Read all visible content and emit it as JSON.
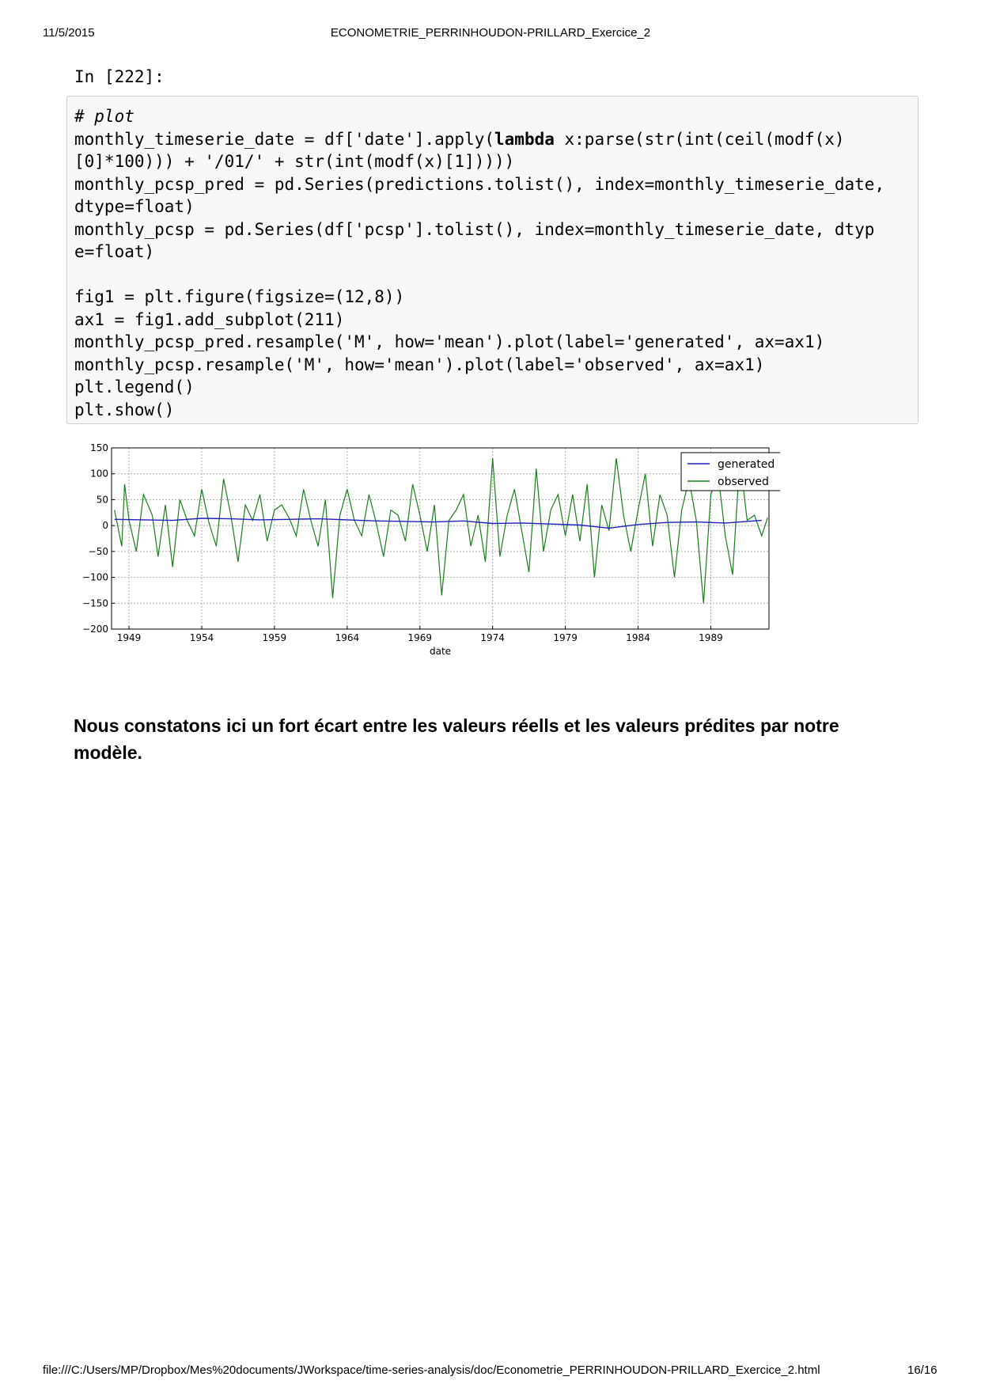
{
  "header": {
    "date": "11/5/2015",
    "title": "ECONOMETRIE_PERRINHOUDON-PRILLARD_Exercice_2"
  },
  "cell": {
    "prompt": "In [222]:",
    "lines": [
      [
        {
          "t": "# plot",
          "c": "cmt"
        }
      ],
      [
        {
          "t": "monthly_timeserie_date = df['date'].apply("
        },
        {
          "t": "lambda",
          "c": "kw"
        },
        {
          "t": " x:parse(str(int(ceil(modf(x)"
        }
      ],
      [
        {
          "t": "[0]*100))) + '/01/' + str(int(modf(x)[1]))))"
        }
      ],
      [
        {
          "t": "monthly_pcsp_pred = pd.Series(predictions.tolist(), index=monthly_timeserie_date,"
        }
      ],
      [
        {
          "t": "dtype=float)"
        }
      ],
      [
        {
          "t": "monthly_pcsp = pd.Series(df['pcsp'].tolist(), index=monthly_timeserie_date, dtyp"
        }
      ],
      [
        {
          "t": "e=float)"
        }
      ],
      [
        {
          "t": ""
        }
      ],
      [
        {
          "t": "fig1 = plt.figure(figsize=(12,8))"
        }
      ],
      [
        {
          "t": "ax1 = fig1.add_subplot(211)"
        }
      ],
      [
        {
          "t": "monthly_pcsp_pred.resample('M', how='mean').plot(label='generated', ax=ax1)"
        }
      ],
      [
        {
          "t": "monthly_pcsp.resample('M', how='mean').plot(label='observed', ax=ax1)"
        }
      ],
      [
        {
          "t": "plt.legend()"
        }
      ],
      [
        {
          "t": "plt.show()"
        }
      ]
    ]
  },
  "chart_data": {
    "type": "line",
    "title": "",
    "xlabel": "date",
    "ylabel": "",
    "xlim": [
      1947.8,
      1993.0
    ],
    "ylim": [
      -200,
      150
    ],
    "xticks": [
      1949,
      1954,
      1959,
      1964,
      1969,
      1974,
      1979,
      1984,
      1989
    ],
    "xtick_labels": [
      "1949",
      "1954",
      "1959",
      "1964",
      "1969",
      "1974",
      "1979",
      "1984",
      "1989"
    ],
    "yticks": [
      150,
      100,
      50,
      0,
      -50,
      -100,
      -150,
      -200
    ],
    "ytick_labels": [
      "150",
      "100",
      "50",
      "0",
      "−50",
      "−100",
      "−150",
      "−200"
    ],
    "grid": true,
    "legend_position": "top-right",
    "series": [
      {
        "name": "generated",
        "color": "#1f1fbf",
        "x": [
          1948,
          1950,
          1952,
          1954,
          1956,
          1958,
          1960,
          1962,
          1964,
          1966,
          1968,
          1970,
          1972,
          1974,
          1976,
          1978,
          1980,
          1982,
          1984,
          1986,
          1988,
          1990,
          1992.5
        ],
        "y": [
          12,
          11,
          10,
          14,
          13,
          11,
          12,
          13,
          11,
          9,
          8,
          7,
          9,
          4,
          5,
          3,
          1,
          -5,
          2,
          6,
          7,
          5,
          10
        ]
      },
      {
        "name": "observed",
        "color": "#1a7f1a",
        "x": [
          1948.0,
          1948.5,
          1948.7,
          1949.0,
          1949.5,
          1950.0,
          1950.6,
          1951.0,
          1951.5,
          1952.0,
          1952.5,
          1953.0,
          1953.5,
          1954.0,
          1954.5,
          1955.0,
          1955.5,
          1956.0,
          1956.5,
          1957.0,
          1957.5,
          1958.0,
          1958.5,
          1959.0,
          1959.5,
          1960.0,
          1960.5,
          1961.0,
          1961.5,
          1962.0,
          1962.5,
          1963.0,
          1963.5,
          1964.0,
          1964.5,
          1965.0,
          1965.5,
          1966.0,
          1966.5,
          1967.0,
          1967.5,
          1968.0,
          1968.5,
          1969.0,
          1969.5,
          1970.0,
          1970.5,
          1971.0,
          1971.5,
          1972.0,
          1972.5,
          1973.0,
          1973.5,
          1974.0,
          1974.5,
          1975.0,
          1975.5,
          1976.0,
          1976.5,
          1977.0,
          1977.5,
          1978.0,
          1978.5,
          1979.0,
          1979.5,
          1980.0,
          1980.5,
          1981.0,
          1981.5,
          1982.0,
          1982.5,
          1983.0,
          1983.5,
          1984.0,
          1984.5,
          1985.0,
          1985.5,
          1986.0,
          1986.5,
          1987.0,
          1987.5,
          1988.0,
          1988.5,
          1989.0,
          1989.5,
          1990.0,
          1990.5,
          1991.0,
          1991.5,
          1992.0,
          1992.5,
          1992.9
        ],
        "y": [
          30,
          -40,
          80,
          10,
          -50,
          60,
          20,
          -60,
          40,
          -80,
          50,
          10,
          -20,
          70,
          5,
          -40,
          90,
          20,
          -70,
          40,
          10,
          60,
          -30,
          30,
          40,
          15,
          -20,
          70,
          10,
          -40,
          50,
          -140,
          20,
          70,
          10,
          -20,
          60,
          5,
          -60,
          30,
          20,
          -30,
          80,
          20,
          -50,
          40,
          -135,
          10,
          30,
          60,
          -40,
          20,
          -70,
          130,
          -60,
          20,
          70,
          -10,
          -90,
          110,
          -50,
          30,
          60,
          -20,
          60,
          -30,
          80,
          -100,
          40,
          -10,
          130,
          20,
          -50,
          30,
          100,
          -40,
          60,
          20,
          -100,
          30,
          90,
          10,
          -150,
          60,
          100,
          -20,
          -95,
          130,
          10,
          20,
          -20,
          15
        ]
      }
    ]
  },
  "paragraph": "Nous constatons ici un fort écart entre les valeurs réells et les valeurs prédites par notre modèle.",
  "footer": {
    "path": "file:///C:/Users/MP/Dropbox/Mes%20documents/JWorkspace/time-series-analysis/doc/Econometrie_PERRINHOUDON-PRILLARD_Exercice_2.html",
    "page": "16/16"
  }
}
